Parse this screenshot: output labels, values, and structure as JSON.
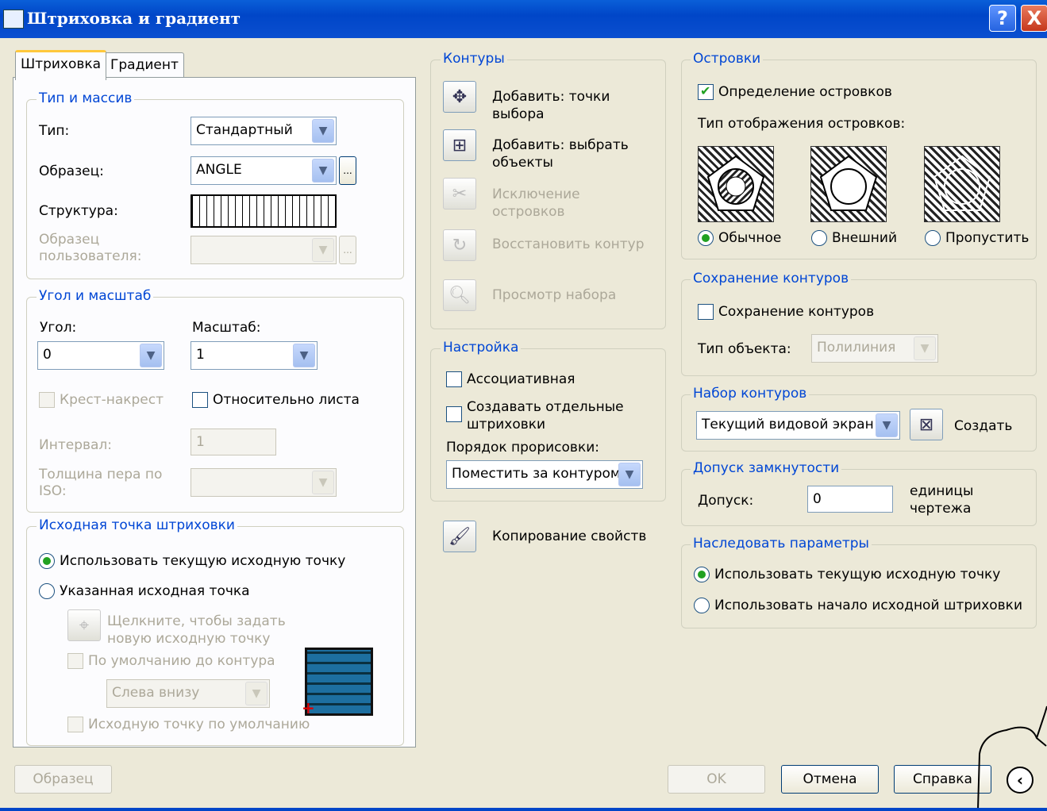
{
  "window": {
    "title": "Штриховка и градиент",
    "help": "?",
    "close": "X"
  },
  "tabs": [
    {
      "label": "Штриховка"
    },
    {
      "label": "Градиент"
    }
  ],
  "type_pattern": {
    "legend": "Тип и массив",
    "type_label": "Тип:",
    "type_value": "Стандартный",
    "pattern_label": "Образец:",
    "pattern_value": "ANGLE",
    "pattern_browse": "...",
    "swatch_label": "Структура:",
    "custom_label": "Образец пользователя:",
    "custom_browse": "..."
  },
  "angle_scale": {
    "legend": "Угол и масштаб",
    "angle_label": "Угол:",
    "angle_value": "0",
    "scale_label": "Масштаб:",
    "scale_value": "1",
    "double_label": "Крест-накрест",
    "double_checked": false,
    "relative_label": "Относительно листа",
    "relative_checked": false,
    "spacing_label": "Интервал:",
    "spacing_value": "1",
    "iso_label": "Толщина пера по ISO:"
  },
  "origin": {
    "legend": "Исходная точка штриховки",
    "use_current": "Использовать текущую исходную точку",
    "specified": "Указанная исходная точка",
    "click_label": "Щелкните, чтобы задать новую исходную точку",
    "default_extents": "По умолчанию до контура",
    "position_value": "Слева внизу",
    "store_default": "Исходную точку по умолчанию",
    "selected": "use_current"
  },
  "boundaries": {
    "legend": "Контуры",
    "add_pick": "Добавить: точки выбора",
    "add_select": "Добавить: выбрать объекты",
    "remove": "Исключение островков",
    "recreate": "Восстановить контур",
    "view": "Просмотр набора"
  },
  "options": {
    "legend": "Настройка",
    "associative": "Ассоциативная",
    "separate": "Создавать отдельные штриховки",
    "draw_order_label": "Порядок прорисовки:",
    "draw_order_value": "Поместить за контуром"
  },
  "inherit_props": "Копирование свойств",
  "islands": {
    "legend": "Островки",
    "detect_label": "Определение островков",
    "detect_checked": true,
    "style_label": "Тип отображения островков:",
    "normal": "Обычное",
    "outer": "Внешний",
    "ignore": "Пропустить",
    "selected": "normal"
  },
  "retain": {
    "legend": "Сохранение контуров",
    "retain_label": "Сохранение контуров",
    "object_type_label": "Тип объекта:",
    "object_type_value": "Полилиния"
  },
  "boundary_set": {
    "legend": "Набор контуров",
    "value": "Текущий видовой экран",
    "new_label": "Создать"
  },
  "gap": {
    "legend": "Допуск замкнутости",
    "label": "Допуск:",
    "value": "0",
    "units": "единицы чертежа"
  },
  "inherit_options": {
    "legend": "Наследовать параметры",
    "use_current": "Использовать текущую исходную точку",
    "use_source": "Использовать начало исходной штриховки",
    "selected": "use_current"
  },
  "footer": {
    "preview": "Образец",
    "ok": "OK",
    "cancel": "Отмена",
    "help": "Справка",
    "more": "‹"
  }
}
